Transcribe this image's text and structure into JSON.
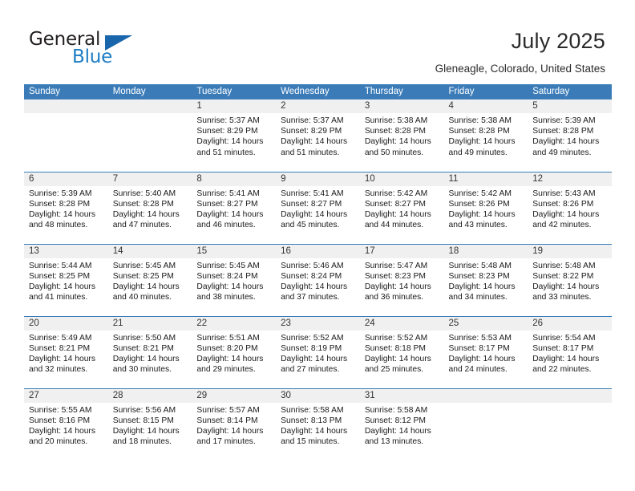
{
  "brand": {
    "name_part1": "General",
    "name_part2": "Blue"
  },
  "header": {
    "title": "July 2025",
    "location": "Gleneagle, Colorado, United States"
  },
  "colors": {
    "header_blue": "#3b7cb8",
    "brand_blue": "#1a7cc4",
    "daynum_band": "#f0f0f0",
    "text": "#1a1a1a"
  },
  "labels": {
    "sunrise_prefix": "Sunrise: ",
    "sunset_prefix": "Sunset: ",
    "daylight_prefix": "Daylight: "
  },
  "weekdays": [
    "Sunday",
    "Monday",
    "Tuesday",
    "Wednesday",
    "Thursday",
    "Friday",
    "Saturday"
  ],
  "weeks": [
    [
      {
        "day": "",
        "empty": true
      },
      {
        "day": "",
        "empty": true
      },
      {
        "day": "1",
        "sunrise": "Sunrise: 5:37 AM",
        "sunset": "Sunset: 8:29 PM",
        "daylight_line1": "Daylight: 14 hours",
        "daylight_line2": "and 51 minutes."
      },
      {
        "day": "2",
        "sunrise": "Sunrise: 5:37 AM",
        "sunset": "Sunset: 8:29 PM",
        "daylight_line1": "Daylight: 14 hours",
        "daylight_line2": "and 51 minutes."
      },
      {
        "day": "3",
        "sunrise": "Sunrise: 5:38 AM",
        "sunset": "Sunset: 8:28 PM",
        "daylight_line1": "Daylight: 14 hours",
        "daylight_line2": "and 50 minutes."
      },
      {
        "day": "4",
        "sunrise": "Sunrise: 5:38 AM",
        "sunset": "Sunset: 8:28 PM",
        "daylight_line1": "Daylight: 14 hours",
        "daylight_line2": "and 49 minutes."
      },
      {
        "day": "5",
        "sunrise": "Sunrise: 5:39 AM",
        "sunset": "Sunset: 8:28 PM",
        "daylight_line1": "Daylight: 14 hours",
        "daylight_line2": "and 49 minutes."
      }
    ],
    [
      {
        "day": "6",
        "sunrise": "Sunrise: 5:39 AM",
        "sunset": "Sunset: 8:28 PM",
        "daylight_line1": "Daylight: 14 hours",
        "daylight_line2": "and 48 minutes."
      },
      {
        "day": "7",
        "sunrise": "Sunrise: 5:40 AM",
        "sunset": "Sunset: 8:28 PM",
        "daylight_line1": "Daylight: 14 hours",
        "daylight_line2": "and 47 minutes."
      },
      {
        "day": "8",
        "sunrise": "Sunrise: 5:41 AM",
        "sunset": "Sunset: 8:27 PM",
        "daylight_line1": "Daylight: 14 hours",
        "daylight_line2": "and 46 minutes."
      },
      {
        "day": "9",
        "sunrise": "Sunrise: 5:41 AM",
        "sunset": "Sunset: 8:27 PM",
        "daylight_line1": "Daylight: 14 hours",
        "daylight_line2": "and 45 minutes."
      },
      {
        "day": "10",
        "sunrise": "Sunrise: 5:42 AM",
        "sunset": "Sunset: 8:27 PM",
        "daylight_line1": "Daylight: 14 hours",
        "daylight_line2": "and 44 minutes."
      },
      {
        "day": "11",
        "sunrise": "Sunrise: 5:42 AM",
        "sunset": "Sunset: 8:26 PM",
        "daylight_line1": "Daylight: 14 hours",
        "daylight_line2": "and 43 minutes."
      },
      {
        "day": "12",
        "sunrise": "Sunrise: 5:43 AM",
        "sunset": "Sunset: 8:26 PM",
        "daylight_line1": "Daylight: 14 hours",
        "daylight_line2": "and 42 minutes."
      }
    ],
    [
      {
        "day": "13",
        "sunrise": "Sunrise: 5:44 AM",
        "sunset": "Sunset: 8:25 PM",
        "daylight_line1": "Daylight: 14 hours",
        "daylight_line2": "and 41 minutes."
      },
      {
        "day": "14",
        "sunrise": "Sunrise: 5:45 AM",
        "sunset": "Sunset: 8:25 PM",
        "daylight_line1": "Daylight: 14 hours",
        "daylight_line2": "and 40 minutes."
      },
      {
        "day": "15",
        "sunrise": "Sunrise: 5:45 AM",
        "sunset": "Sunset: 8:24 PM",
        "daylight_line1": "Daylight: 14 hours",
        "daylight_line2": "and 38 minutes."
      },
      {
        "day": "16",
        "sunrise": "Sunrise: 5:46 AM",
        "sunset": "Sunset: 8:24 PM",
        "daylight_line1": "Daylight: 14 hours",
        "daylight_line2": "and 37 minutes."
      },
      {
        "day": "17",
        "sunrise": "Sunrise: 5:47 AM",
        "sunset": "Sunset: 8:23 PM",
        "daylight_line1": "Daylight: 14 hours",
        "daylight_line2": "and 36 minutes."
      },
      {
        "day": "18",
        "sunrise": "Sunrise: 5:48 AM",
        "sunset": "Sunset: 8:23 PM",
        "daylight_line1": "Daylight: 14 hours",
        "daylight_line2": "and 34 minutes."
      },
      {
        "day": "19",
        "sunrise": "Sunrise: 5:48 AM",
        "sunset": "Sunset: 8:22 PM",
        "daylight_line1": "Daylight: 14 hours",
        "daylight_line2": "and 33 minutes."
      }
    ],
    [
      {
        "day": "20",
        "sunrise": "Sunrise: 5:49 AM",
        "sunset": "Sunset: 8:21 PM",
        "daylight_line1": "Daylight: 14 hours",
        "daylight_line2": "and 32 minutes."
      },
      {
        "day": "21",
        "sunrise": "Sunrise: 5:50 AM",
        "sunset": "Sunset: 8:21 PM",
        "daylight_line1": "Daylight: 14 hours",
        "daylight_line2": "and 30 minutes."
      },
      {
        "day": "22",
        "sunrise": "Sunrise: 5:51 AM",
        "sunset": "Sunset: 8:20 PM",
        "daylight_line1": "Daylight: 14 hours",
        "daylight_line2": "and 29 minutes."
      },
      {
        "day": "23",
        "sunrise": "Sunrise: 5:52 AM",
        "sunset": "Sunset: 8:19 PM",
        "daylight_line1": "Daylight: 14 hours",
        "daylight_line2": "and 27 minutes."
      },
      {
        "day": "24",
        "sunrise": "Sunrise: 5:52 AM",
        "sunset": "Sunset: 8:18 PM",
        "daylight_line1": "Daylight: 14 hours",
        "daylight_line2": "and 25 minutes."
      },
      {
        "day": "25",
        "sunrise": "Sunrise: 5:53 AM",
        "sunset": "Sunset: 8:17 PM",
        "daylight_line1": "Daylight: 14 hours",
        "daylight_line2": "and 24 minutes."
      },
      {
        "day": "26",
        "sunrise": "Sunrise: 5:54 AM",
        "sunset": "Sunset: 8:17 PM",
        "daylight_line1": "Daylight: 14 hours",
        "daylight_line2": "and 22 minutes."
      }
    ],
    [
      {
        "day": "27",
        "sunrise": "Sunrise: 5:55 AM",
        "sunset": "Sunset: 8:16 PM",
        "daylight_line1": "Daylight: 14 hours",
        "daylight_line2": "and 20 minutes."
      },
      {
        "day": "28",
        "sunrise": "Sunrise: 5:56 AM",
        "sunset": "Sunset: 8:15 PM",
        "daylight_line1": "Daylight: 14 hours",
        "daylight_line2": "and 18 minutes."
      },
      {
        "day": "29",
        "sunrise": "Sunrise: 5:57 AM",
        "sunset": "Sunset: 8:14 PM",
        "daylight_line1": "Daylight: 14 hours",
        "daylight_line2": "and 17 minutes."
      },
      {
        "day": "30",
        "sunrise": "Sunrise: 5:58 AM",
        "sunset": "Sunset: 8:13 PM",
        "daylight_line1": "Daylight: 14 hours",
        "daylight_line2": "and 15 minutes."
      },
      {
        "day": "31",
        "sunrise": "Sunrise: 5:58 AM",
        "sunset": "Sunset: 8:12 PM",
        "daylight_line1": "Daylight: 14 hours",
        "daylight_line2": "and 13 minutes."
      },
      {
        "day": "",
        "empty": true
      },
      {
        "day": "",
        "empty": true
      }
    ]
  ]
}
